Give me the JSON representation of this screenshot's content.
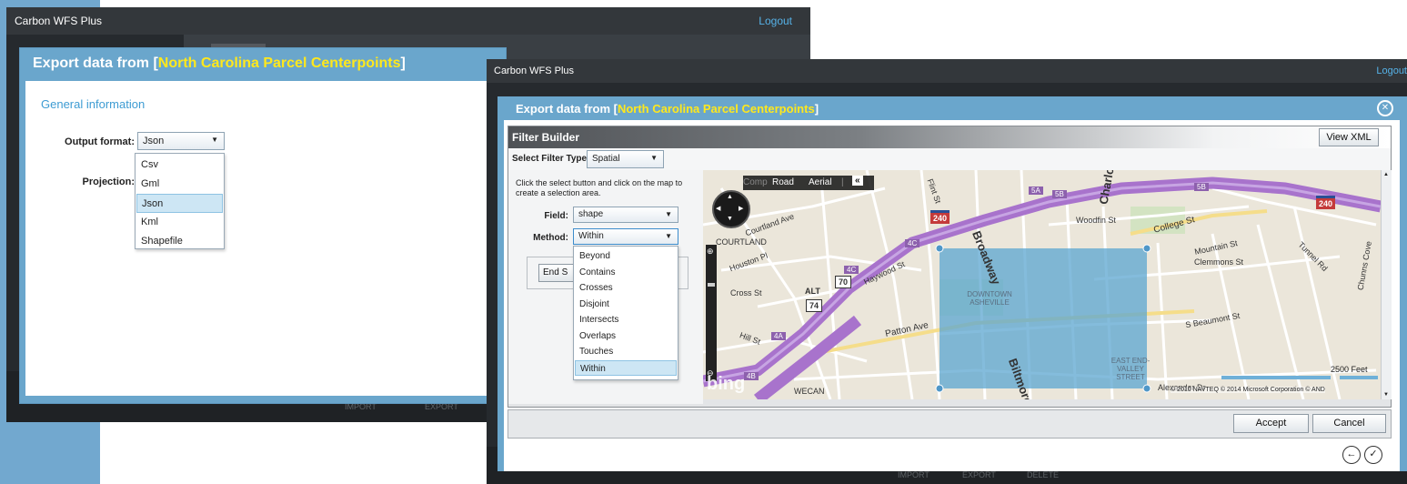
{
  "back_window": {
    "app_title": "Carbon WFS Plus",
    "logout": "Logout",
    "dialog": {
      "title_prefix": "Export data from [",
      "layer_name": "North Carolina Parcel Centerpoints",
      "title_suffix": "]",
      "section": "General information",
      "output_format_label": "Output format:",
      "output_format_value": "Json",
      "projection_label": "Projection:",
      "format_options": [
        "Csv",
        "Gml",
        "Json",
        "Kml",
        "Shapefile"
      ],
      "selected_format": "Json"
    },
    "bottom_labels": [
      "IMPORT",
      "EXPORT"
    ]
  },
  "front_window": {
    "app_title": "Carbon WFS Plus",
    "logout": "Logout",
    "dialog": {
      "title_prefix": "Export data from [",
      "layer_name": "North Carolina Parcel Centerpoints",
      "title_suffix": "]",
      "filter_builder": {
        "title": "Filter Builder",
        "view_xml": "View XML",
        "filter_type_label": "Select Filter Type:",
        "filter_type_value": "Spatial",
        "instructions": "Click the select button and click on the map to create a selection area.",
        "field_label": "Field:",
        "field_value": "shape",
        "method_label": "Method:",
        "method_value": "Within",
        "method_options": [
          "Beyond",
          "Contains",
          "Crosses",
          "Disjoint",
          "Intersects",
          "Overlaps",
          "Touches",
          "Within"
        ],
        "selected_method": "Within",
        "end_select_button": "End S"
      },
      "map": {
        "mode_tabs": [
          "Comp",
          "Road",
          "Aerial",
          "|",
          "«"
        ],
        "logo": "bing",
        "scale_label": "2500 Feet",
        "copyright": "© 2010 NAVTEQ   © 2014 Microsoft Corporation   © AND",
        "labels": {
          "broadway": "Broadway",
          "charlotte_st": "Charlotte St",
          "woodfin": "Woodfin St",
          "college": "College St",
          "mountain": "Mountain St",
          "clemmons": "Clemmons St",
          "tunnel": "Tunnel Rd",
          "chunns": "Chunns Cove",
          "courtland_ave": "Courtland Ave",
          "courtland": "COURTLAND",
          "houston": "Houston Pl",
          "haywood": "Haywood St",
          "patton": "Patton Ave",
          "cross": "Cross St",
          "hill": "Hill St",
          "downtown": "DOWNTOWN ASHEVILLE",
          "east_end": "EAST END-VALLEY STREET",
          "beaumont": "S Beaumont St",
          "biltmore": "Biltmore Av",
          "flint": "Flint St",
          "wecan": "WECAN",
          "alexander": "Alexander Dr",
          "i240a": "240",
          "i240b": "240",
          "r70": "70",
          "r74": "74",
          "alt": "ALT",
          "r4a": "4A",
          "r4b": "4B",
          "r4c": "4C",
          "r4d": "4C",
          "r5a": "5A",
          "r5b": "5B",
          "r5c": "5B"
        }
      },
      "accept": "Accept",
      "cancel": "Cancel"
    },
    "bottom_labels": [
      "IMPORT",
      "EXPORT",
      "DELETE"
    ]
  },
  "colors": {
    "dialog_blue": "#6aa6cc",
    "highlight_yellow": "#ffe81c",
    "link_blue": "#56b2e8",
    "selection_fill": "#5ba6d0",
    "highway_purple": "#b07fd1"
  }
}
